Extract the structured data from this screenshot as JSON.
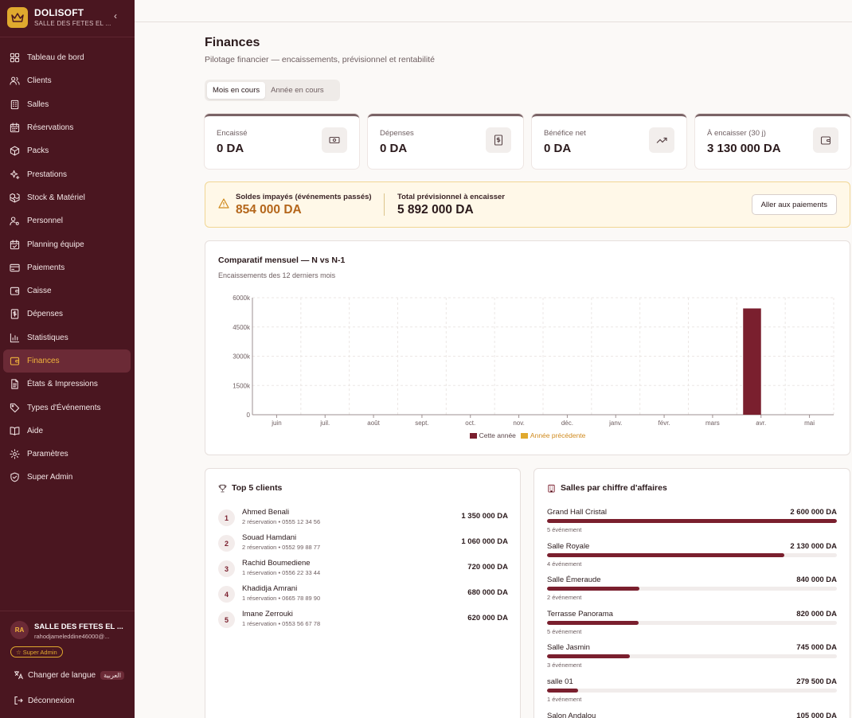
{
  "brand": {
    "name": "DOLISOFT",
    "subtitle": "SALLE DES FETES EL ...",
    "collapse_icon": "chevron-left-icon"
  },
  "nav": [
    {
      "label": "Tableau de bord",
      "icon": "dashboard-icon"
    },
    {
      "label": "Clients",
      "icon": "users-icon"
    },
    {
      "label": "Salles",
      "icon": "building-icon"
    },
    {
      "label": "Réservations",
      "icon": "calendar-icon"
    },
    {
      "label": "Packs",
      "icon": "package-icon"
    },
    {
      "label": "Prestations",
      "icon": "sparkles-icon"
    },
    {
      "label": "Stock & Matériel",
      "icon": "boxes-icon"
    },
    {
      "label": "Personnel",
      "icon": "user-cog-icon"
    },
    {
      "label": "Planning équipe",
      "icon": "calendar-check-icon"
    },
    {
      "label": "Paiements",
      "icon": "credit-card-icon"
    },
    {
      "label": "Caisse",
      "icon": "wallet-icon"
    },
    {
      "label": "Dépenses",
      "icon": "receipt-icon"
    },
    {
      "label": "Statistiques",
      "icon": "bar-chart-icon"
    },
    {
      "label": "Finances",
      "icon": "wallet-icon",
      "active": true
    },
    {
      "label": "États & Impressions",
      "icon": "file-text-icon"
    },
    {
      "label": "Types d'Événements",
      "icon": "tag-icon"
    },
    {
      "label": "Aide",
      "icon": "book-open-icon"
    },
    {
      "label": "Paramètres",
      "icon": "gear-icon"
    },
    {
      "label": "Super Admin",
      "icon": "shield-icon"
    }
  ],
  "user": {
    "initials": "RA",
    "name": "SALLE DES FETES EL ...",
    "email": "rahodjameleddine46000@...",
    "badge": "Super Admin"
  },
  "footer": {
    "language_label": "Changer de langue",
    "language_pill": "العربية",
    "logout_label": "Déconnexion"
  },
  "page": {
    "title": "Finances",
    "subtitle": "Pilotage financier — encaissements, prévisionnel et rentabilité"
  },
  "period_tabs": [
    {
      "label": "Mois en cours",
      "active": true
    },
    {
      "label": "Année en cours",
      "active": false
    }
  ],
  "kpis": [
    {
      "label": "Encaissé",
      "value": "0 DA",
      "icon": "banknote-icon"
    },
    {
      "label": "Dépenses",
      "value": "0 DA",
      "icon": "receipt-icon"
    },
    {
      "label": "Bénéfice net",
      "value": "0 DA",
      "icon": "trending-up-icon"
    },
    {
      "label": "À encaisser (30 j)",
      "value": "3 130 000 DA",
      "icon": "wallet-icon"
    }
  ],
  "alert": {
    "unpaid_label": "Soldes impayés (événements passés)",
    "unpaid_value": "854 000 DA",
    "forecast_label": "Total prévisionnel à encaisser",
    "forecast_value": "5 892 000 DA",
    "button_label": "Aller aux paiements",
    "icon": "warning-icon"
  },
  "chart_card": {
    "title": "Comparatif mensuel — N vs N-1",
    "subtitle": "Encaissements des 12 derniers mois"
  },
  "chart_data": {
    "type": "bar",
    "categories": [
      "juin",
      "juil.",
      "août",
      "sept.",
      "oct.",
      "nov.",
      "déc.",
      "janv.",
      "févr.",
      "mars",
      "avr.",
      "mai"
    ],
    "series": [
      {
        "name": "Cette année",
        "values": [
          0,
          0,
          0,
          0,
          0,
          0,
          0,
          0,
          0,
          0,
          5450000,
          0
        ],
        "color": "#7a1f2e"
      },
      {
        "name": "Année précédente",
        "values": [
          0,
          0,
          0,
          0,
          0,
          0,
          0,
          0,
          0,
          0,
          0,
          0
        ],
        "color": "#e0a92e"
      }
    ],
    "yticks": [
      "0",
      "1500k",
      "3000k",
      "4500k",
      "6000k"
    ],
    "ylim": [
      0,
      6000000
    ],
    "grid": true,
    "legend": "bottom-center"
  },
  "top_clients": {
    "title": "Top 5 clients",
    "icon": "trophy-icon",
    "items": [
      {
        "rank": "1",
        "name": "Ahmed Benali",
        "meta": "2 réservation • 0555 12 34 56",
        "amount": "1 350 000 DA"
      },
      {
        "rank": "2",
        "name": "Souad Hamdani",
        "meta": "2 réservation • 0552 99 88 77",
        "amount": "1 060 000 DA"
      },
      {
        "rank": "3",
        "name": "Rachid Boumediene",
        "meta": "1 réservation • 0556 22 33 44",
        "amount": "720 000 DA"
      },
      {
        "rank": "4",
        "name": "Khadidja Amrani",
        "meta": "1 réservation • 0665 78 89 90",
        "amount": "680 000 DA"
      },
      {
        "rank": "5",
        "name": "Imane Zerrouki",
        "meta": "1 réservation • 0553 56 67 78",
        "amount": "620 000 DA"
      }
    ]
  },
  "salles": {
    "title": "Salles par chiffre d'affaires",
    "icon": "building-icon",
    "items": [
      {
        "name": "Grand Hall Cristal",
        "amount": "2 600 000 DA",
        "meta": "5 événement",
        "ratio": 1.0
      },
      {
        "name": "Salle Royale",
        "amount": "2 130 000 DA",
        "meta": "4 événement",
        "ratio": 0.82
      },
      {
        "name": "Salle Émeraude",
        "amount": "840 000 DA",
        "meta": "2 événement",
        "ratio": 0.32
      },
      {
        "name": "Terrasse Panorama",
        "amount": "820 000 DA",
        "meta": "5 événement",
        "ratio": 0.315
      },
      {
        "name": "Salle Jasmin",
        "amount": "745 000 DA",
        "meta": "3 événement",
        "ratio": 0.287
      },
      {
        "name": "salle 01",
        "amount": "279 500 DA",
        "meta": "1 événement",
        "ratio": 0.107
      },
      {
        "name": "Salon Andalou",
        "amount": "105 000 DA",
        "meta": "",
        "ratio": 0.04
      }
    ]
  }
}
